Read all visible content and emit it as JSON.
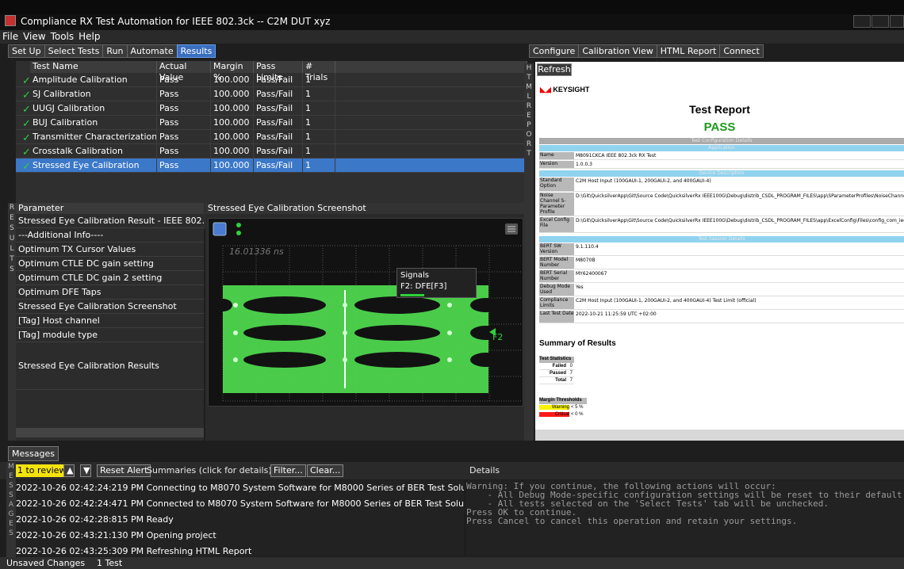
{
  "window": {
    "title": "Compliance RX Test Automation for IEEE 802.3ck -- C2M DUT xyz"
  },
  "menu": [
    "File",
    "View",
    "Tools",
    "Help"
  ],
  "left_tabs": [
    "Set Up",
    "Select Tests",
    "Run",
    "Automate",
    "Results"
  ],
  "right_tabs": [
    "Configure",
    "Calibration View",
    "HTML Report",
    "Connect"
  ],
  "results": {
    "headers": [
      "Test Name",
      "Actual Value",
      "Margin %",
      "Pass Limits",
      "# Trials"
    ],
    "rows": [
      {
        "name": "Amplitude Calibration",
        "actual": "Pass",
        "margin": "100.000",
        "limits": "Pass/Fail",
        "trials": "1"
      },
      {
        "name": "SJ Calibration",
        "actual": "Pass",
        "margin": "100.000",
        "limits": "Pass/Fail",
        "trials": "1"
      },
      {
        "name": "UUGJ Calibration",
        "actual": "Pass",
        "margin": "100.000",
        "limits": "Pass/Fail",
        "trials": "1"
      },
      {
        "name": "BUJ Calibration",
        "actual": "Pass",
        "margin": "100.000",
        "limits": "Pass/Fail",
        "trials": "1"
      },
      {
        "name": "Transmitter Characterization",
        "actual": "Pass",
        "margin": "100.000",
        "limits": "Pass/Fail",
        "trials": "1"
      },
      {
        "name": "Crosstalk Calibration",
        "actual": "Pass",
        "margin": "100.000",
        "limits": "Pass/Fail",
        "trials": "1"
      },
      {
        "name": "Stressed Eye Calibration",
        "actual": "Pass",
        "margin": "100.000",
        "limits": "Pass/Fail",
        "trials": "1"
      }
    ]
  },
  "params": {
    "header": "Parameter",
    "items": [
      "Stressed Eye Calibration Result - IEEE 802.3",
      "---Additional Info----",
      "Optimum TX Cursor Values",
      "Optimum CTLE DC gain setting",
      "Optimum CTLE DC gain 2 setting",
      "Optimum DFE Taps",
      "Stressed Eye Calibration Screenshot",
      "[Tag] Host channel",
      "[Tag] module type",
      "Stressed Eye Calibration Results"
    ],
    "vtab": "RESULTS"
  },
  "screenshot": {
    "header": "Stressed Eye Calibration Screenshot",
    "time_label": "16.01336 ns",
    "signals_title": "Signals",
    "signal": "F2: DFE[F3]",
    "marker": "F2"
  },
  "report": {
    "refresh": "Refresh",
    "logo": "KEYSIGHT",
    "title": "Test Report",
    "status": "PASS",
    "sections": [
      "Test Configuration Details",
      "Application",
      "Device Description",
      "Test Session Details"
    ],
    "app_rows": [
      {
        "k": "Name",
        "v": "M8091CKCA IEEE 802.3ck RX Test"
      },
      {
        "k": "Version",
        "v": "1.0.0.3"
      }
    ],
    "device_rows": [
      {
        "k": "Standard Option",
        "v": "C2M Host Input (100GAUI-1, 200GAUI-2, and 400GAUI-4)"
      },
      {
        "k": "Noise Channel S-Parameter Profile",
        "v": "D:\\Git\\QuicksilverApp\\Git\\Source Code\\QuicksilverRx IEEE100G\\Debug\\distrib_CSDL_PROGRAM_FILES\\app\\SParameterProfiles\\NoiseChannel.s4p"
      },
      {
        "k": "Excel Config File",
        "v": "D:\\Git\\QuicksilverApp\\Git\\Source Code\\QuicksilverRx IEEE100G\\Debug\\distrib_CSDL_PROGRAM_FILES\\app\\ExcelConfig\\Files\\config_com_ieee8023_93a+3ck_"
      }
    ],
    "session_rows": [
      {
        "k": "BERT SW Version",
        "v": "9.1.110.4"
      },
      {
        "k": "BERT Model Number",
        "v": "M8070B"
      },
      {
        "k": "BERT Serial Number",
        "v": "MY62400067"
      },
      {
        "k": "Debug Mode Used",
        "v": "Yes"
      },
      {
        "k": "Compliance Limits",
        "v": "C2M Host Input (100GAUI-1, 200GAUI-2, and 400GAUI-4) Test Limit (official)"
      },
      {
        "k": "Last Test Date",
        "v": "2022-10-21 11:25:59 UTC +02:00"
      }
    ],
    "summary_title": "Summary of Results",
    "stats_title": "Test Statistics",
    "stats": [
      {
        "k": "Failed",
        "v": "0"
      },
      {
        "k": "Passed",
        "v": "7"
      },
      {
        "k": "Total",
        "v": "7"
      }
    ],
    "thresholds_title": "Margin Thresholds",
    "thresholds": [
      {
        "k": "Warning",
        "v": "< 5 %",
        "color": "#f7f300"
      },
      {
        "k": "Critical",
        "v": "< 0 %",
        "color": "#ff1a1a"
      }
    ],
    "vtab": "HTML REPORT"
  },
  "messages": {
    "tab": "Messages",
    "review": "1 to review",
    "reset": "Reset Alert",
    "summaries": "Summaries (click for details)",
    "filter": "Filter...",
    "clear": "Clear...",
    "vtab": "MESSAGES",
    "lines": [
      "2022-10-26 02:42:24:219 PM Connecting to M8070 System Software for M8000 Series of BER Test Solu",
      "2022-10-26 02:42:24:471 PM Connected to M8070 System Software for M8000 Series of BER Test Solu",
      "2022-10-26 02:42:28:815 PM Ready",
      "2022-10-26 02:43:21:130 PM Opening project",
      "2022-10-26 02:43:25:309 PM Refreshing HTML Report"
    ]
  },
  "details": {
    "title": "Details",
    "lines": [
      "Warning: If you continue, the following actions will occur:",
      "    - All Debug Mode-specific configuration settings will be reset to their default values.",
      "    - All tests selected on the 'Select Tests' tab will be unchecked.",
      "",
      "Press OK to continue.",
      "Press Cancel to cancel this operation and retain your settings."
    ]
  },
  "status": {
    "unsaved": "Unsaved Changes",
    "tests": "1 Test"
  },
  "colors": {
    "accent": "#3b78c8",
    "pass": "#2ed13a",
    "review": "#f4e30c",
    "eye": "#57e857"
  }
}
